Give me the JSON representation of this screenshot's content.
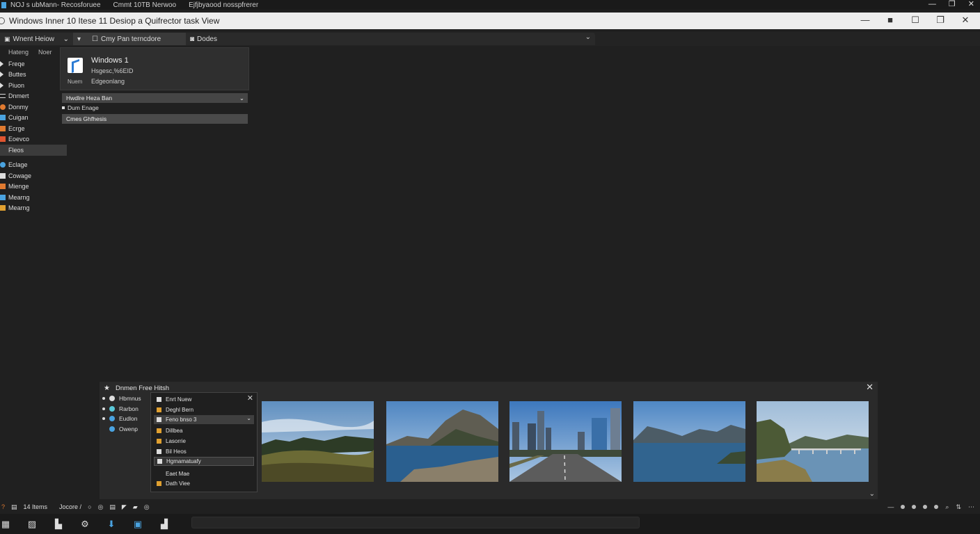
{
  "sysbar": {
    "segments": [
      "NOJ s ubMann- Recosforuee",
      "Cmmt 10TB  Nerwoo",
      "Ejfjbyaood nosspfrerer"
    ],
    "controls": [
      "—",
      "❐",
      "✕"
    ]
  },
  "window": {
    "title": "Windows  Inner 10 Itese 11 Desiop a Quifrector task View",
    "controls": [
      "—",
      "■",
      "☐",
      "❐",
      "✕"
    ]
  },
  "toolbar": {
    "home_label": "Wnent Heiow",
    "dropdown_label": "Cmy Pan terncdore",
    "doc_label": "Dodes",
    "chevron": "⌄"
  },
  "sidebar": {
    "tabs": [
      "Hateng",
      "Noer"
    ],
    "items": [
      {
        "label": "Freqe",
        "icon": "arrow-icon",
        "color": "#dddddd"
      },
      {
        "label": "Buttes",
        "icon": "play-icon",
        "color": "#dddddd"
      },
      {
        "label": "Piuon",
        "icon": "play-icon",
        "color": "#dddddd"
      },
      {
        "label": "Dnmert",
        "icon": "lines-icon",
        "color": "#dddddd"
      },
      {
        "label": "Donmy",
        "icon": "circle-icon",
        "color": "#e07a30"
      },
      {
        "label": "Cuigan",
        "icon": "bolt-icon",
        "color": "#4aa3e0"
      },
      {
        "label": "Ecrge",
        "icon": "square-icon",
        "color": "#e07a30"
      },
      {
        "label": "Eoevco",
        "icon": "square-icon",
        "color": "#e05530"
      },
      {
        "label": "Fleos",
        "icon": "none",
        "color": "#dddddd"
      },
      {
        "label": "Eclage",
        "icon": "cloud-icon",
        "color": "#4aa3e0"
      },
      {
        "label": "Cowage",
        "icon": "link-icon",
        "color": "#dddddd"
      },
      {
        "label": "Mienge",
        "icon": "folder-icon",
        "color": "#e07a30"
      },
      {
        "label": "Mearng",
        "icon": "window-icon",
        "color": "#4aa3e0"
      },
      {
        "label": "Mearng",
        "icon": "window-icon",
        "color": "#e0a030"
      }
    ]
  },
  "popup": {
    "line1": "Windows 1",
    "line2": "Hsgesc,%6EID",
    "line3": "Edgeonlang",
    "small": "Nuem",
    "select_label": "Hwdlre Heza Ban",
    "option1": "Dum Enage",
    "option2": "Cmes Ghfhesis"
  },
  "taskview": {
    "title": "Dnmen Free Hitsh",
    "close": "✕",
    "more": "⌄",
    "list": [
      {
        "label": "Hbmnus",
        "color": "#dddddd"
      },
      {
        "label": "Rarbon",
        "color": "#5ac8d8"
      },
      {
        "label": "Eudlon",
        "color": "#4aa3e0"
      },
      {
        "label": "Owenp",
        "color": "#4aa3e0"
      }
    ],
    "context": {
      "close": "✕",
      "items": [
        {
          "label": "Enrt Nuew",
          "color": "#dddddd"
        },
        {
          "label": "Deghl Bern",
          "color": "#e0a030"
        },
        {
          "label": "Feno bnso 3",
          "color": "#dddddd"
        },
        {
          "label": "Dillbea",
          "color": "#e0a030"
        },
        {
          "label": "Lasorrie",
          "color": "#e0a030"
        },
        {
          "label": "Bil Heos",
          "color": "#dddddd"
        },
        {
          "label": "Hgmamatuafy",
          "color": "#dddddd"
        },
        {
          "label": "Eaet Mae",
          "color": "none"
        },
        {
          "label": "Dath Viee",
          "color": "#e0a030"
        }
      ]
    },
    "thumbnails": [
      "meadow-forest",
      "mountain-lake",
      "city-street",
      "lake-mountains",
      "bridge-coast"
    ]
  },
  "status": {
    "left_text": "14 Items",
    "path_text": "Jocore /",
    "right_icons": [
      "minus-icon",
      "dot-icon",
      "dot-icon",
      "dot-icon",
      "dot-icon",
      "search-icon",
      "sort-icon",
      "dots-icon"
    ]
  },
  "taskbar": {
    "icons": [
      "start-icon",
      "files-icon",
      "apps-icon",
      "settings-icon",
      "download-icon",
      "window-icon",
      "store-icon"
    ]
  }
}
